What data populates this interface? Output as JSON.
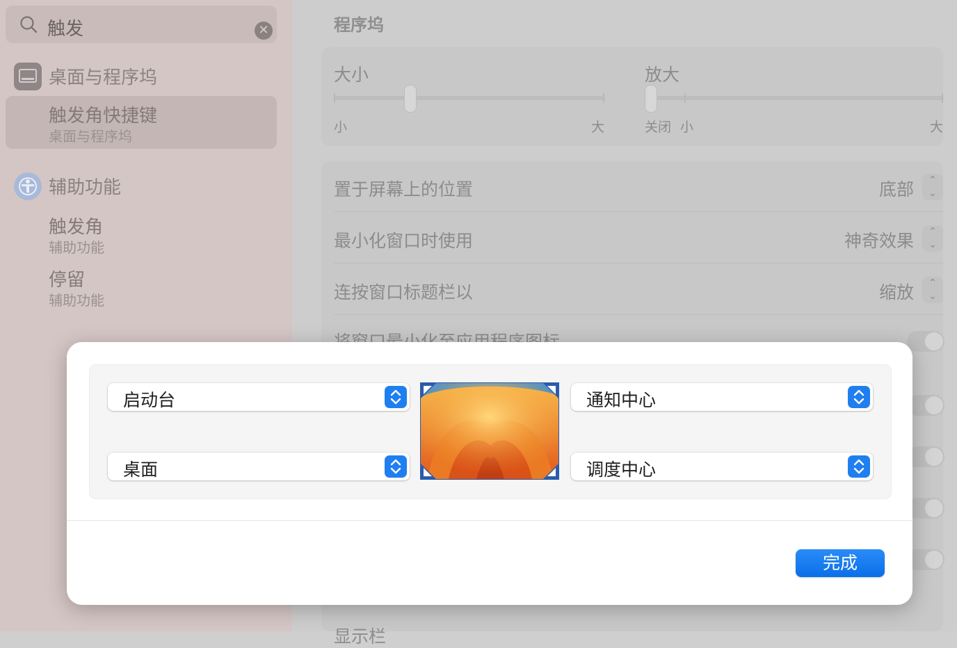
{
  "search": {
    "query": "触发"
  },
  "sidebar": {
    "sections": [
      {
        "title": "桌面与程序坞",
        "items": [
          {
            "title": "触发角快捷键",
            "subtitle": "桌面与程序坞",
            "selected": true
          }
        ]
      },
      {
        "title": "辅助功能",
        "items": [
          {
            "title": "触发角",
            "subtitle": "辅助功能"
          },
          {
            "title": "停留",
            "subtitle": "辅助功能"
          }
        ]
      }
    ]
  },
  "main": {
    "title": "程序坞",
    "size": {
      "label": "大小",
      "min": "小",
      "max": "大",
      "value": 0.28
    },
    "magnification": {
      "label": "放大",
      "off": "关闭",
      "min": "小",
      "max": "大",
      "value": 0.0
    },
    "rows": [
      {
        "label": "置于屏幕上的位置",
        "value": "底部"
      },
      {
        "label": "最小化窗口时使用",
        "value": "神奇效果"
      },
      {
        "label": "连按窗口标题栏以",
        "value": "缩放"
      },
      {
        "label": "将窗口最小化至应用程序图标"
      }
    ],
    "bottom_partial": "显示栏"
  },
  "hot_corners_dialog": {
    "top_left": "启动台",
    "bottom_left": "桌面",
    "top_right": "通知中心",
    "bottom_right": "调度中心",
    "done_label": "完成"
  },
  "colors": {
    "accent": "#1f7ff0"
  }
}
